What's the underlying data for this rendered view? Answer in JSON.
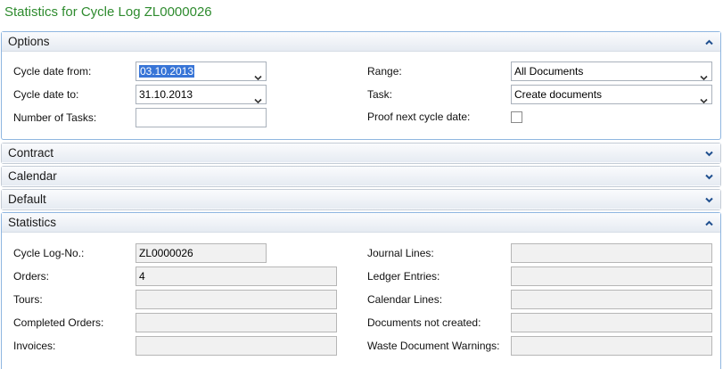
{
  "page": {
    "title": "Statistics for Cycle Log ZL0000026"
  },
  "options": {
    "header": "Options",
    "cycle_date_from": {
      "label": "Cycle date from:",
      "value": "03.10.2013"
    },
    "cycle_date_to": {
      "label": "Cycle date to:",
      "value": "31.10.2013"
    },
    "number_of_tasks": {
      "label": "Number of Tasks:",
      "value": ""
    },
    "range": {
      "label": "Range:",
      "value": "All Documents"
    },
    "task": {
      "label": "Task:",
      "value": "Create documents"
    },
    "proof_next_cycle_date": {
      "label": "Proof next cycle date:",
      "checked": false
    }
  },
  "contract": {
    "header": "Contract"
  },
  "calendar": {
    "header": "Calendar"
  },
  "default": {
    "header": "Default"
  },
  "statistics": {
    "header": "Statistics",
    "cycle_log_no": {
      "label": "Cycle Log-No.:",
      "value": "ZL0000026"
    },
    "orders": {
      "label": "Orders:",
      "value": "4"
    },
    "tours": {
      "label": "Tours:",
      "value": ""
    },
    "completed_orders": {
      "label": "Completed Orders:",
      "value": ""
    },
    "invoices": {
      "label": "Invoices:",
      "value": ""
    },
    "journal_lines": {
      "label": "Journal Lines:",
      "value": ""
    },
    "ledger_entries": {
      "label": "Ledger Entries:",
      "value": ""
    },
    "calendar_lines": {
      "label": "Calendar Lines:",
      "value": ""
    },
    "documents_not_created": {
      "label": "Documents not created:",
      "value": ""
    },
    "waste_document_warnings": {
      "label": "Waste Document Warnings:",
      "value": ""
    }
  },
  "icons": {
    "expand": "chevron-down-icon",
    "collapse": "chevron-up-icon",
    "dropdown": "dropdown-arrow-icon"
  },
  "colors": {
    "title": "#2e8b2e",
    "selection": "#3875d7",
    "panel_border": "#8fb6e0"
  }
}
